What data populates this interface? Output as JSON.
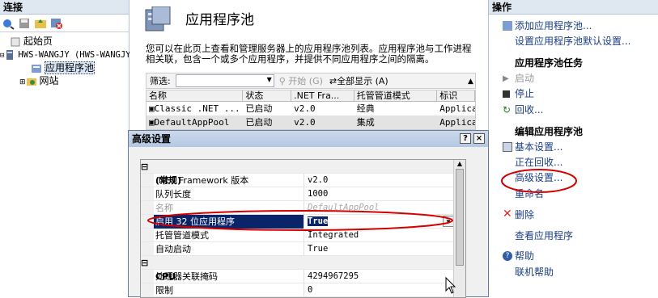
{
  "left_pane": {
    "header": "连接",
    "tree": [
      {
        "label": "起始页"
      },
      {
        "label": "HWS-WANGJY (HWS-WANGJY\\Administrator)"
      },
      {
        "label": "应用程序池"
      },
      {
        "label": "网站"
      }
    ]
  },
  "middle": {
    "title": "应用程序池",
    "description": "您可以在此页上查看和管理服务器上的应用程序池列表。应用程序池与工作进程相关联，包含一个或多个应用程序，并提供不同应用程序之间的隔离。",
    "filter": {
      "label": "筛选:",
      "start": "开始 (G)",
      "show_all": "全部显示 (A)"
    },
    "columns": [
      "名称",
      "状态",
      ".NET Fra...",
      "托管管道模式",
      "标识"
    ],
    "rows": [
      [
        "Classic .NET ...",
        "已启动",
        "v2.0",
        "经典",
        "Applica"
      ],
      [
        "DefaultAppPool",
        "已启动",
        "v2.0",
        "集成",
        "Applica"
      ]
    ]
  },
  "dialog": {
    "title": "高级设置",
    "help_btn": "?",
    "close_btn": "×",
    "rows": [
      {
        "type": "cat",
        "name": "(常规)",
        "sign": "⊟"
      },
      {
        "name": ".NET Framework 版本",
        "value": "v2.0"
      },
      {
        "name": "队列长度",
        "value": "1000"
      },
      {
        "name": "名称",
        "value": "DefaultAppPool",
        "disabled": true
      },
      {
        "name": "启用 32 位应用程序",
        "value": "True",
        "selected": true
      },
      {
        "name": "托管管道模式",
        "value": "Integrated"
      },
      {
        "name": "自动启动",
        "value": "True"
      },
      {
        "type": "cat",
        "name": "CPU",
        "sign": "⊟"
      },
      {
        "name": "处理器关联掩码",
        "value": "4294967295"
      },
      {
        "name": "限制",
        "value": "0"
      }
    ]
  },
  "right_pane": {
    "header": "操作",
    "add_pool": "添加应用程序池...",
    "set_defaults": "设置应用程序池默认设置...",
    "task_header": "应用程序池任务",
    "start": "启动",
    "stop": "停止",
    "recycle": "回收...",
    "edit_header": "编辑应用程序池",
    "basic": "基本设置...",
    "recycling": "正在回收...",
    "advanced": "高级设置...",
    "rename": "重命名",
    "delete": "删除",
    "view_apps": "查看应用程序",
    "help": "帮助",
    "online_help": "联机帮助"
  },
  "colors": {
    "annotation": "#d40000",
    "link": "#1a3f85",
    "selection": "#0a246a"
  }
}
